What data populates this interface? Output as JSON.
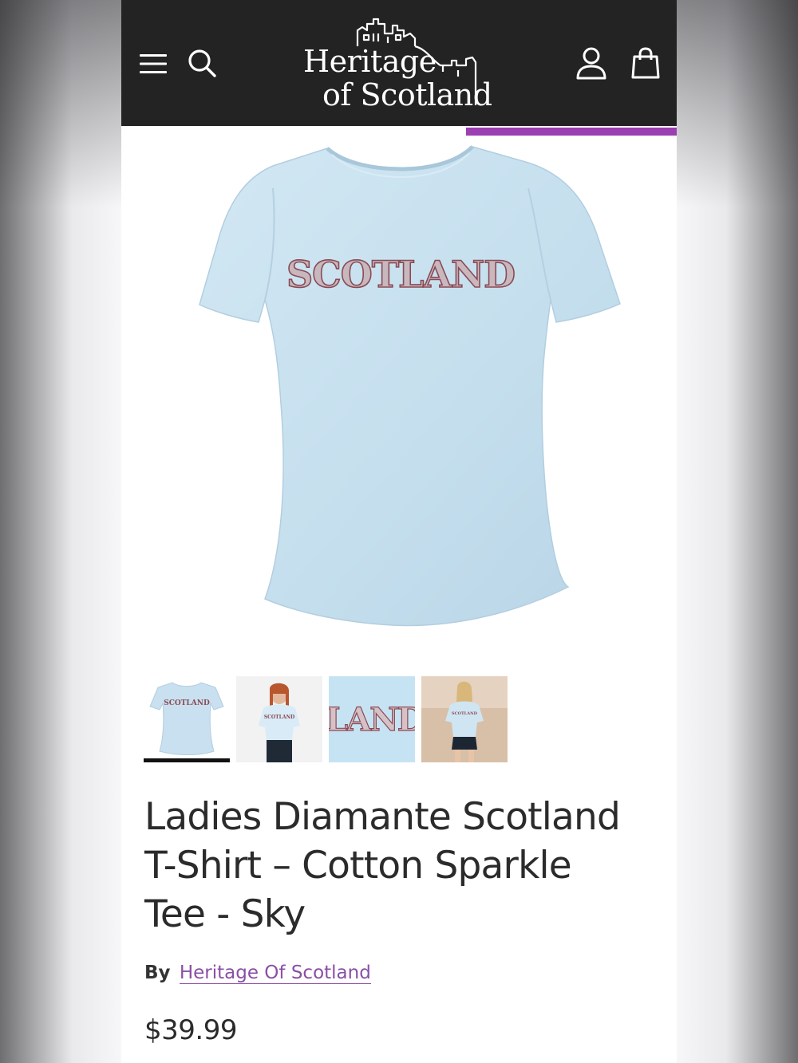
{
  "header": {
    "logo_line1": "Heritage",
    "logo_line2": "of Scotland",
    "background": "#232323",
    "icons": {
      "menu": "hamburger-menu-icon",
      "search": "search-icon",
      "account": "account-icon",
      "cart": "shopping-bag-icon"
    }
  },
  "promo_bar_color": "#9b3fb3",
  "hero": {
    "shirt_print": "SCOTLAND",
    "shirt_color": "#c8e0ef"
  },
  "thumbnails": [
    {
      "name": "front-view",
      "print": "SCOTLAND",
      "selected": true
    },
    {
      "name": "model-front-view",
      "print": "SCOTLAND",
      "selected": false
    },
    {
      "name": "print-closeup",
      "print": "LAND",
      "selected": false
    },
    {
      "name": "model-lifestyle-view",
      "print": "SCOTLAND",
      "selected": false
    }
  ],
  "product": {
    "title_line1": "Ladies Diamante Scotland",
    "title_line2": "T-Shirt – Cotton Sparkle",
    "title_line3": "Tee - Sky",
    "by_label": "By",
    "brand": "Heritage Of Scotland",
    "price": "$39.99",
    "link_color": "#8a4fa6"
  }
}
